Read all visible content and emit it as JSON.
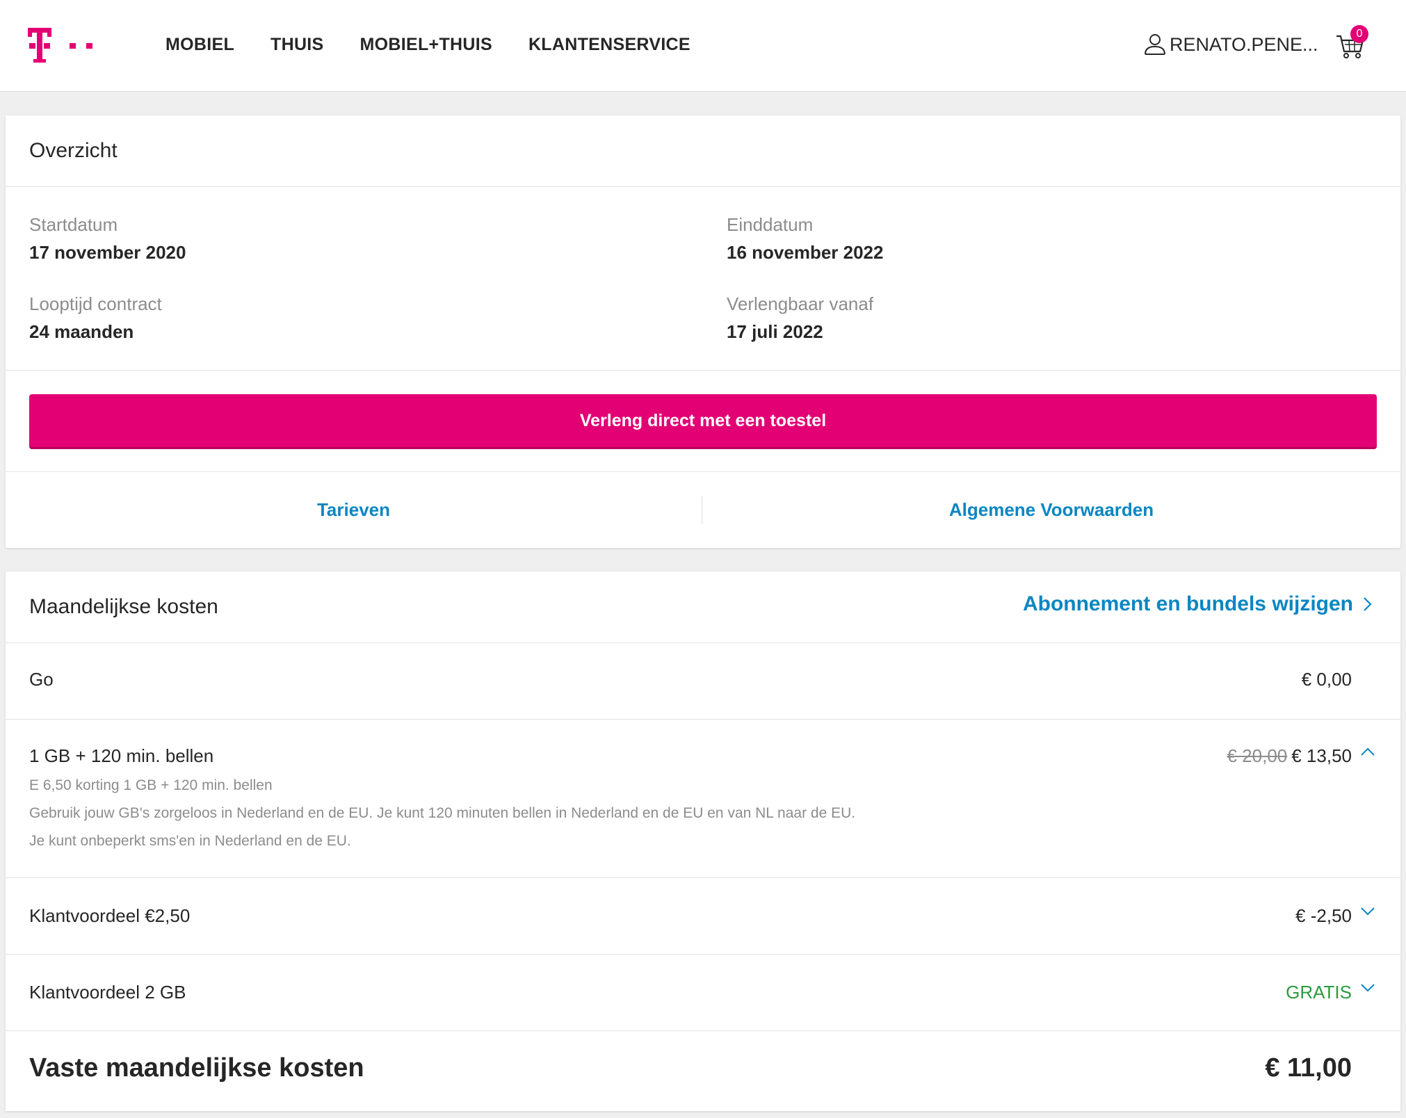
{
  "header": {
    "nav": [
      "MOBIEL",
      "THUIS",
      "MOBIEL+THUIS",
      "KLANTENSERVICE"
    ],
    "user_name": "RENATO.PENE...",
    "cart_count": "0",
    "brand_color": "#e20074"
  },
  "overview": {
    "title": "Overzicht",
    "start_label": "Startdatum",
    "start_value": "17 november 2020",
    "end_label": "Einddatum",
    "end_value": "16 november 2022",
    "term_label": "Looptijd contract",
    "term_value": "24 maanden",
    "renew_label": "Verlengbaar vanaf",
    "renew_value": "17 juli 2022",
    "cta_label": "Verleng direct met een toestel",
    "link_rates": "Tarieven",
    "link_terms": "Algemene Voorwaarden"
  },
  "monthly": {
    "title": "Maandelijkse kosten",
    "change_link": "Abonnement en bundels wijzigen",
    "rows": [
      {
        "name": "Go",
        "price": "€ 0,00"
      },
      {
        "name": "1 GB + 120 min. bellen",
        "old_price": "€ 20,00",
        "price": "€ 13,50",
        "details": [
          "E 6,50 korting 1 GB + 120 min. bellen",
          "Gebruik jouw GB's zorgeloos in Nederland en de EU. Je kunt 120 minuten bellen in Nederland en de EU en van NL naar de EU.",
          "Je kunt onbeperkt sms'en in Nederland en de EU."
        ]
      },
      {
        "name": "Klantvoordeel €2,50",
        "price": "€ -2,50"
      },
      {
        "name": "Klantvoordeel 2 GB",
        "price": "GRATIS"
      }
    ],
    "total_label": "Vaste maandelijkse kosten",
    "total_price": "€ 11,00",
    "link_color": "#0a86c2",
    "free_color": "#2b9a3f"
  },
  "icons": {
    "logo": "telekom-logo",
    "user": "user-icon",
    "cart": "cart-icon",
    "chevron_right": "chevron-right-icon",
    "chevron_up": "chevron-up-icon",
    "chevron_down": "chevron-down-icon"
  }
}
